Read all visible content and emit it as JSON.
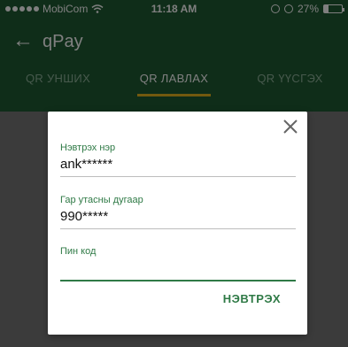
{
  "status_bar": {
    "carrier": "MobiCom",
    "time": "11:18 AM",
    "battery": "27%",
    "battery_level": 0.27,
    "wifi_icon": "wifi-icon",
    "alarm_icon": "alarm-icon"
  },
  "navbar": {
    "back_icon": "←",
    "title": "qPay"
  },
  "tabs": [
    {
      "label": "QR УНШИХ",
      "active": false
    },
    {
      "label": "QR ЛАВЛАХ",
      "active": true
    },
    {
      "label": "QR ҮҮСГЭХ",
      "active": false
    }
  ],
  "dialog": {
    "fields": [
      {
        "label": "Нэвтрэх нэр",
        "value": "ank******"
      },
      {
        "label": "Гар утасны дугаар",
        "value": "990*****"
      },
      {
        "label": "Пин код",
        "value": ""
      }
    ],
    "submit_label": "НЭВТРЭХ"
  },
  "colors": {
    "header": "#1f5a33",
    "accent": "#2f7a46",
    "tab_indicator": "#e6b21e"
  }
}
